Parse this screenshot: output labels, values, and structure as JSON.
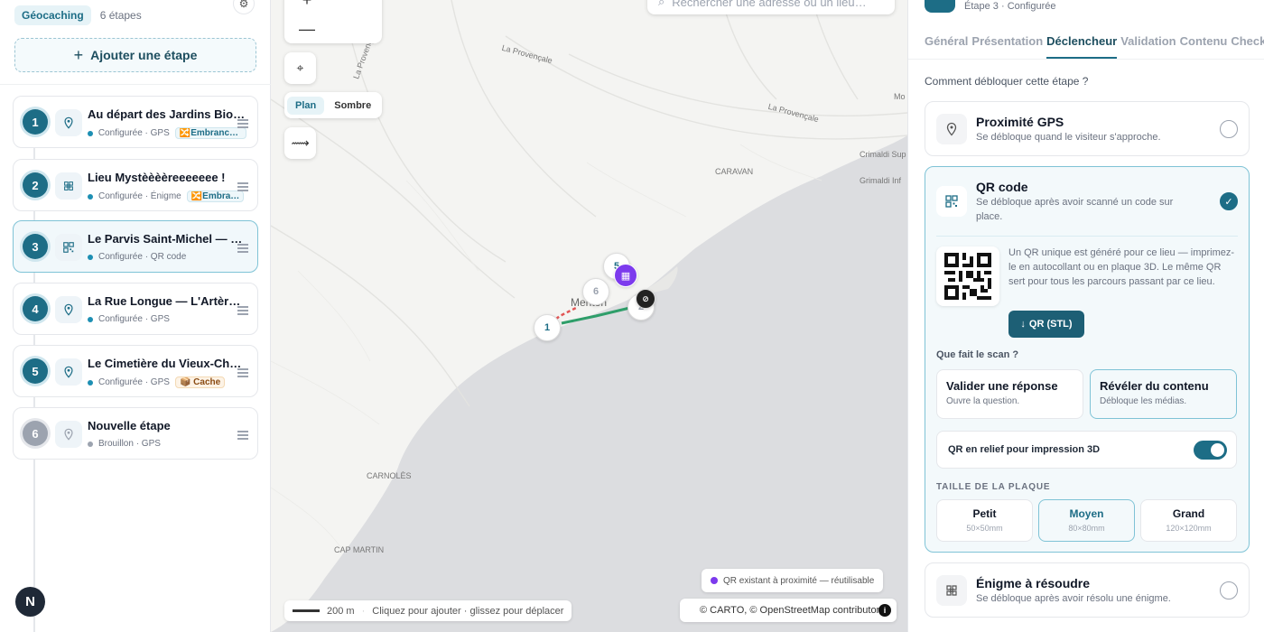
{
  "sidebar": {
    "tag": "Géocaching",
    "step_count": "6 étapes",
    "add_label": "Ajouter une étape",
    "avatar_letter": "N",
    "steps": [
      {
        "number": "1",
        "title": "Au départ des Jardins Biov…",
        "meta": "Configurée · GPS",
        "badge": "🔀Embranch…",
        "icon": "pin-icon"
      },
      {
        "number": "2",
        "title": "Lieu Mystèèèèreeeeeee !",
        "meta": "Configurée · Énigme",
        "badge": "🔀Embra…",
        "icon": "puzzle-icon"
      },
      {
        "number": "3",
        "title": "Le Parvis Saint-Michel — Le C…",
        "meta": "Configurée · QR code",
        "badge": "",
        "icon": "qr-icon"
      },
      {
        "number": "4",
        "title": "La Rue Longue — L'Artère …",
        "meta": "Configurée · GPS",
        "badge": "",
        "icon": "pin-icon"
      },
      {
        "number": "5",
        "title": "Le Cimetière du Vieux-Châ…",
        "meta": "Configurée · GPS",
        "badge": "📦 Cache",
        "icon": "pin-icon"
      },
      {
        "number": "6",
        "title": "Nouvelle étape",
        "meta": "Brouillon · GPS",
        "badge": "",
        "icon": "pin-icon"
      }
    ]
  },
  "map": {
    "zoom_in": "+",
    "zoom_out": "—",
    "style_plan": "Plan",
    "style_dark": "Sombre",
    "search_placeholder": "Rechercher une adresse ou un lieu…",
    "legend": "QR existant à proximité — réutilisable",
    "attribution": "© CARTO, © OpenStreetMap contributors",
    "scale": "200 m",
    "hint": "Cliquez pour ajouter · glissez pour déplacer",
    "labels": [
      "La Provençale",
      "La Provençale",
      "La Provençale",
      "Crimaldi Sup",
      "Grimaldi Inf",
      "CARAVAN",
      "Mo",
      "Menton",
      "CARNOLÈS",
      "CAP MARTIN"
    ],
    "markers": [
      "1",
      "2",
      "5",
      "6"
    ]
  },
  "panel": {
    "subtitle": "Étape 3 · Configurée",
    "tabs": [
      "Général",
      "Présentation",
      "Déclencheur",
      "Validation",
      "Contenu",
      "Checkpoint"
    ],
    "active_tab": "Déclencheur",
    "question": "Comment débloquer cette étape ?",
    "gps": {
      "title": "Proximité GPS",
      "desc": "Se débloque quand le visiteur s'approche."
    },
    "qr": {
      "title": "QR code",
      "desc": "Se débloque après avoir scanné un code sur place.",
      "info": "Un QR unique est généré pour ce lieu — imprimez-le en autocollant ou en plaque 3D. Le même QR sert pour tous les parcours passant par ce lieu.",
      "download": "QR (STL)",
      "scan_label": "Que fait le scan ?",
      "scan_options": [
        {
          "title": "Valider une réponse",
          "desc": "Ouvre la question."
        },
        {
          "title": "Révéler du contenu",
          "desc": "Débloque les médias."
        }
      ],
      "relief_label": "QR en relief pour impression 3D",
      "relief_on": true,
      "size_label": "TAILLE DE LA PLAQUE",
      "sizes": [
        {
          "title": "Petit",
          "desc": "50×50mm"
        },
        {
          "title": "Moyen",
          "desc": "80×80mm"
        },
        {
          "title": "Grand",
          "desc": "120×120mm"
        }
      ],
      "selected_size": "Moyen"
    },
    "enigme": {
      "title": "Énigme à résoudre",
      "desc": "Se débloque après avoir résolu une énigme."
    }
  },
  "colors": {
    "accent": "#1d6d86",
    "accent_light": "#e6f3f7",
    "qr_purple": "#7c3aed"
  }
}
